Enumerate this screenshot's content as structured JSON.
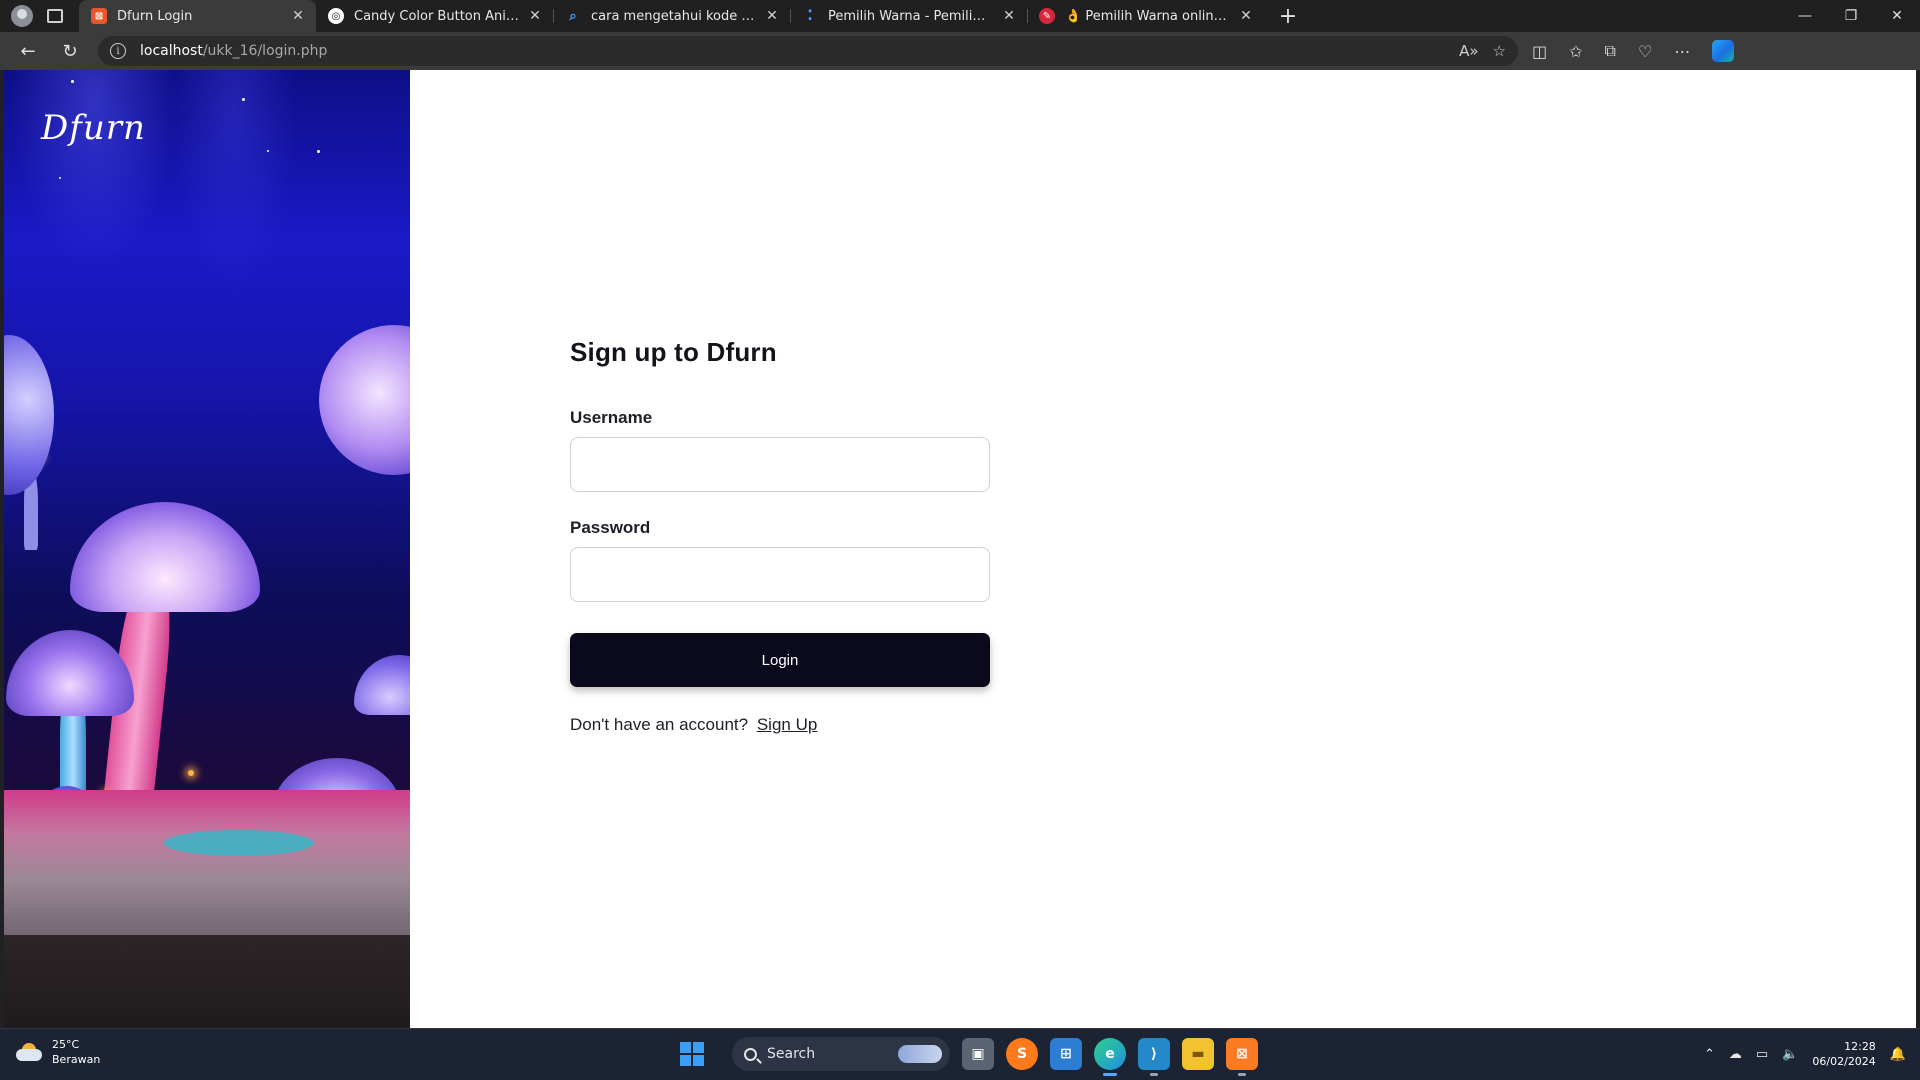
{
  "browser": {
    "tabs": [
      {
        "title": "Dfurn Login",
        "favicon_color": "#e8572a",
        "favicon_glyph": "⊠",
        "active": true
      },
      {
        "title": "Candy Color Button Animation",
        "favicon_color": "#1f1f1f",
        "favicon_glyph": "◎",
        "active": false
      },
      {
        "title": "cara mengetahui kode warna dari",
        "favicon_color": "#202020",
        "favicon_glyph": "⌕",
        "active": false
      },
      {
        "title": "Pemilih Warna - Pemilih Warna H",
        "favicon_color": "#202020",
        "favicon_glyph": "⁚",
        "active": false
      },
      {
        "title": "👌 Pemilih Warna online | Pemili",
        "favicon_color": "#d7263d",
        "favicon_glyph": "✎",
        "active": false
      }
    ],
    "address": {
      "host": "localhost",
      "path": "/ukk_16/login.php"
    }
  },
  "page": {
    "brand": "Dfurn",
    "form": {
      "title": "Sign up to Dfurn",
      "username_label": "Username",
      "username_value": "",
      "password_label": "Password",
      "password_value": "",
      "login_label": "Login",
      "prompt": "Don't have an account?",
      "signup_link": "Sign Up"
    }
  },
  "taskbar": {
    "weather": {
      "temp": "25°C",
      "condition": "Berawan"
    },
    "search_label": "Search",
    "apps": [
      {
        "name": "task-view",
        "color": "#6b7380",
        "glyph": "▣"
      },
      {
        "name": "sublime-text",
        "color": "#ff7a1a",
        "glyph": "S"
      },
      {
        "name": "microsoft-store",
        "color": "#2d7dd2",
        "glyph": "⊞"
      },
      {
        "name": "edge",
        "color": "#1fa0d8",
        "glyph": "e"
      },
      {
        "name": "vscode",
        "color": "#2489ca",
        "glyph": "⟩"
      },
      {
        "name": "file-explorer",
        "color": "#f2c230",
        "glyph": "▬"
      },
      {
        "name": "xampp",
        "color": "#fb7a24",
        "glyph": "⊠"
      }
    ],
    "clock": {
      "time": "12:28",
      "date": "06/02/2024"
    }
  }
}
